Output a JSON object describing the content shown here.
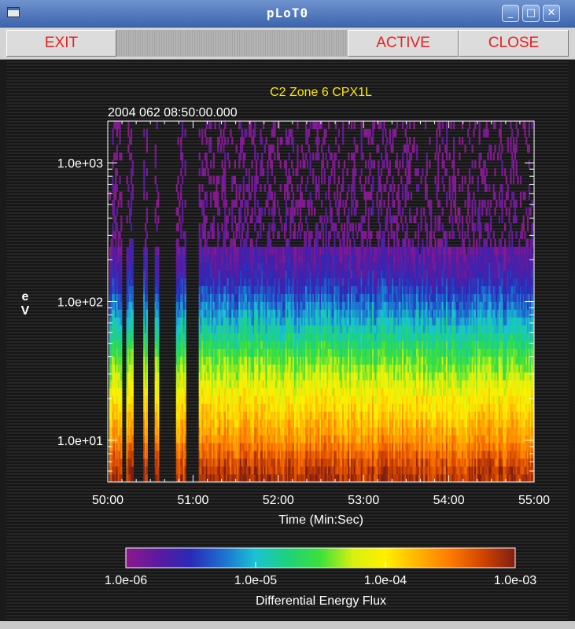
{
  "window": {
    "title": "pLoT0",
    "controls": {
      "minimize": "_",
      "maximize": "□",
      "close": "✕"
    }
  },
  "toolbar": {
    "exit_label": "EXIT",
    "active_label": "ACTIVE",
    "close_label": "CLOSE"
  },
  "chart_data": {
    "type": "heatmap",
    "title": "C2 Zone 6 CPX1L",
    "subtitle": "2004 062 08:50:00.000",
    "xlabel": "Time (Min:Sec)",
    "ylabel": "eV",
    "x_ticks": [
      "50:00",
      "51:00",
      "52:00",
      "53:00",
      "54:00",
      "55:00"
    ],
    "x_range_seconds": [
      0,
      300
    ],
    "y_scale": "log",
    "y_range": [
      5.0,
      2000.0
    ],
    "y_ticks": [
      {
        "value": 1000,
        "label": "1.0e+03"
      },
      {
        "value": 100,
        "label": "1.0e+02"
      },
      {
        "value": 10,
        "label": "1.0e+01"
      }
    ],
    "colorbar": {
      "label": "Differential Energy Flux",
      "scale": "log",
      "range": [
        1e-06,
        0.001
      ],
      "ticks": [
        "1.0e-06",
        "1.0e-05",
        "1.0e-04",
        "1.0e-03"
      ]
    },
    "data_gaps_seconds": [
      [
        0,
        1
      ],
      [
        10,
        13
      ],
      [
        18,
        25
      ],
      [
        28,
        33
      ],
      [
        36,
        48
      ],
      [
        55,
        64
      ]
    ],
    "flux_profile": [
      {
        "ev": 5,
        "log_flux": -3.1
      },
      {
        "ev": 7,
        "log_flux": -3.3
      },
      {
        "ev": 10,
        "log_flux": -3.6
      },
      {
        "ev": 20,
        "log_flux": -4.0
      },
      {
        "ev": 40,
        "log_flux": -4.5
      },
      {
        "ev": 70,
        "log_flux": -5.0
      },
      {
        "ev": 150,
        "log_flux": -5.6
      },
      {
        "ev": 300,
        "log_flux": -5.9
      },
      {
        "ev": 1000,
        "log_flux": -6.0
      }
    ]
  },
  "colors": {
    "title": "#ffe600",
    "axis": "#ffffff",
    "button_text": "#e8211f",
    "colormap": [
      "#8b1a8b",
      "#5a1aa0",
      "#2a2ab8",
      "#1d6fd0",
      "#19c4d2",
      "#1ed27a",
      "#3ee03a",
      "#d8f010",
      "#fff000",
      "#ffb400",
      "#ff7a00",
      "#d24400",
      "#7e1e12"
    ]
  }
}
